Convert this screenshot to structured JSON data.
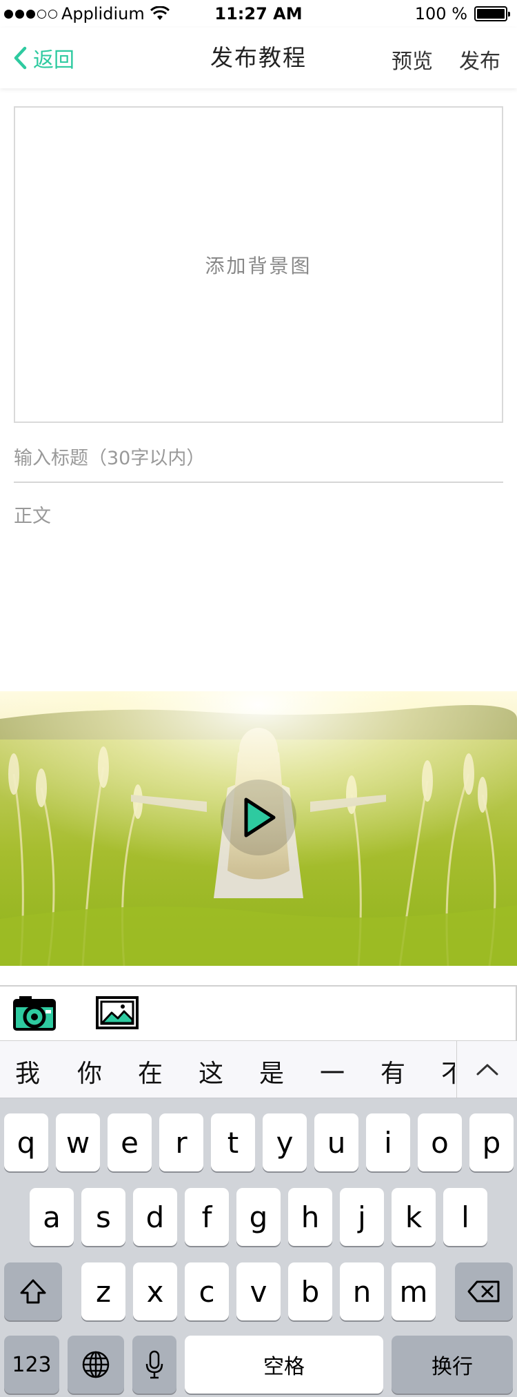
{
  "status_bar": {
    "carrier": "Applidium",
    "time": "11:27 AM",
    "battery": "100 %"
  },
  "nav": {
    "back_label": "返回",
    "title": "发布教程",
    "preview_label": "预览",
    "publish_label": "发布"
  },
  "colors": {
    "accent": "#2ecaa0",
    "keyboard_bg": "#d1d4d9"
  },
  "editor": {
    "background_placeholder": "添加背景图",
    "title_placeholder": "输入标题（30字以内）",
    "body_placeholder": "正文"
  },
  "media": {
    "play_icon": "play-icon"
  },
  "toolbar": {
    "camera_icon": "camera-icon",
    "image_icon": "image-icon"
  },
  "candidates": [
    "我",
    "你",
    "在",
    "这",
    "是",
    "一",
    "有",
    "不"
  ],
  "keyboard": {
    "row1": [
      "q",
      "w",
      "e",
      "r",
      "t",
      "y",
      "u",
      "i",
      "o",
      "p"
    ],
    "row2": [
      "a",
      "s",
      "d",
      "f",
      "g",
      "h",
      "j",
      "k",
      "l"
    ],
    "row3": [
      "z",
      "x",
      "c",
      "v",
      "b",
      "n",
      "m"
    ],
    "numbers_label": "123",
    "space_label": "空格",
    "return_label": "换行"
  }
}
